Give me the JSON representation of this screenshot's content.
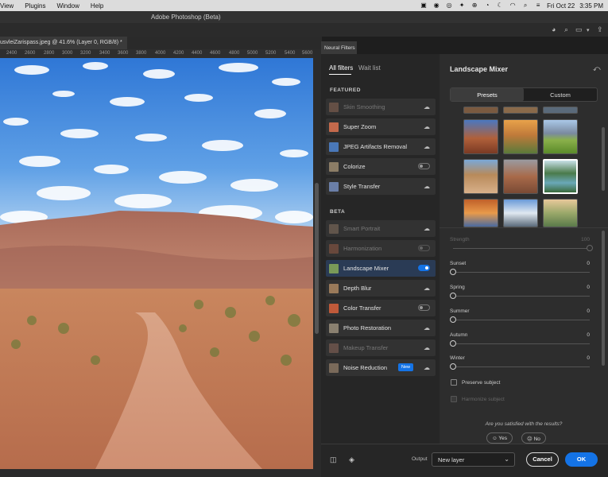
{
  "menubar": {
    "items": [
      "View",
      "Plugins",
      "Window",
      "Help"
    ],
    "date": "Fri Oct 22",
    "time": "3:35 PM"
  },
  "app_title": "Adobe Photoshop (Beta)",
  "document": {
    "tab_title": "usvleiZarispass.jpeg @ 41.6% (Layer 0, RGB/8) *"
  },
  "ruler": [
    "2400",
    "2600",
    "2800",
    "3000",
    "3200",
    "3400",
    "3600",
    "3800",
    "4000",
    "4200",
    "4400",
    "4600",
    "4800",
    "5000",
    "5200",
    "5400",
    "5600"
  ],
  "neural_filters": {
    "panel_tab": "Neural Filters",
    "tabs": {
      "all": "All filters",
      "wait": "Wait list"
    },
    "featured_label": "FEATURED",
    "beta_label": "BETA",
    "featured": [
      {
        "label": "Skin Smoothing",
        "state": "cloud",
        "disabled": true
      },
      {
        "label": "Super Zoom",
        "state": "cloud"
      },
      {
        "label": "JPEG Artifacts Removal",
        "state": "cloud"
      },
      {
        "label": "Colorize",
        "state": "toggle-off"
      },
      {
        "label": "Style Transfer",
        "state": "cloud"
      }
    ],
    "beta": [
      {
        "label": "Smart Portrait",
        "state": "cloud",
        "disabled": true
      },
      {
        "label": "Harmonization",
        "state": "toggle-off",
        "disabled": true
      },
      {
        "label": "Landscape Mixer",
        "state": "toggle-on",
        "selected": true
      },
      {
        "label": "Depth Blur",
        "state": "cloud"
      },
      {
        "label": "Color Transfer",
        "state": "toggle-off"
      },
      {
        "label": "Photo Restoration",
        "state": "cloud"
      },
      {
        "label": "Makeup Transfer",
        "state": "cloud",
        "disabled": true
      },
      {
        "label": "Noise Reduction",
        "state": "cloud",
        "badge": "New"
      }
    ]
  },
  "landscape_mixer": {
    "title": "Landscape Mixer",
    "tabs": {
      "presets": "Presets",
      "custom": "Custom"
    },
    "sliders": [
      {
        "label": "Strength",
        "value": "100",
        "level": 1.0,
        "disabled": true
      },
      {
        "label": "Sunset",
        "value": "0",
        "level": 0
      },
      {
        "label": "Spring",
        "value": "0",
        "level": 0
      },
      {
        "label": "Summer",
        "value": "0",
        "level": 0
      },
      {
        "label": "Autumn",
        "value": "0",
        "level": 0
      },
      {
        "label": "Winter",
        "value": "0",
        "level": 0
      }
    ],
    "preserve_subject": "Preserve subject",
    "harmonize_subject": "Harmonize subject",
    "satisfied_question": "Are you satisfied with the results?",
    "yes": "Yes",
    "no": "No"
  },
  "bottom": {
    "output_label": "Output",
    "output_value": "New layer",
    "cancel": "Cancel",
    "ok": "OK"
  }
}
